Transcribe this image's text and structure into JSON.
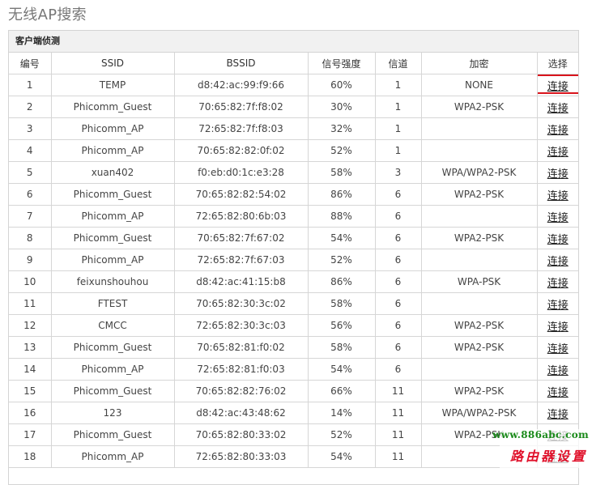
{
  "page": {
    "title": "无线AP搜索"
  },
  "panel": {
    "title": "客户端侦测"
  },
  "table": {
    "headers": [
      "编号",
      "SSID",
      "BSSID",
      "信号强度",
      "信道",
      "加密",
      "选择"
    ],
    "connect_label": "连接",
    "rows": [
      {
        "no": "1",
        "ssid": "TEMP",
        "bssid": "d8:42:ac:99:f9:66",
        "signal": "60%",
        "channel": "1",
        "enc": "NONE",
        "action": "连接",
        "highlighted": true
      },
      {
        "no": "2",
        "ssid": "Phicomm_Guest",
        "bssid": "70:65:82:7f:f8:02",
        "signal": "30%",
        "channel": "1",
        "enc": "WPA2-PSK",
        "action": "连接"
      },
      {
        "no": "3",
        "ssid": "Phicomm_AP",
        "bssid": "72:65:82:7f:f8:03",
        "signal": "32%",
        "channel": "1",
        "enc": "",
        "action": "连接"
      },
      {
        "no": "4",
        "ssid": "Phicomm_AP",
        "bssid": "70:65:82:82:0f:02",
        "signal": "52%",
        "channel": "1",
        "enc": "",
        "action": "连接"
      },
      {
        "no": "5",
        "ssid": "xuan402",
        "bssid": "f0:eb:d0:1c:e3:28",
        "signal": "58%",
        "channel": "3",
        "enc": "WPA/WPA2-PSK",
        "action": "连接"
      },
      {
        "no": "6",
        "ssid": "Phicomm_Guest",
        "bssid": "70:65:82:82:54:02",
        "signal": "86%",
        "channel": "6",
        "enc": "WPA2-PSK",
        "action": "连接"
      },
      {
        "no": "7",
        "ssid": "Phicomm_AP",
        "bssid": "72:65:82:80:6b:03",
        "signal": "88%",
        "channel": "6",
        "enc": "",
        "action": "连接"
      },
      {
        "no": "8",
        "ssid": "Phicomm_Guest",
        "bssid": "70:65:82:7f:67:02",
        "signal": "54%",
        "channel": "6",
        "enc": "WPA2-PSK",
        "action": "连接"
      },
      {
        "no": "9",
        "ssid": "Phicomm_AP",
        "bssid": "72:65:82:7f:67:03",
        "signal": "52%",
        "channel": "6",
        "enc": "",
        "action": "连接"
      },
      {
        "no": "10",
        "ssid": "feixunshouhou",
        "bssid": "d8:42:ac:41:15:b8",
        "signal": "86%",
        "channel": "6",
        "enc": "WPA-PSK",
        "action": "连接"
      },
      {
        "no": "11",
        "ssid": "FTEST",
        "bssid": "70:65:82:30:3c:02",
        "signal": "58%",
        "channel": "6",
        "enc": "",
        "action": "连接"
      },
      {
        "no": "12",
        "ssid": "CMCC",
        "bssid": "72:65:82:30:3c:03",
        "signal": "56%",
        "channel": "6",
        "enc": "WPA2-PSK",
        "action": "连接"
      },
      {
        "no": "13",
        "ssid": "Phicomm_Guest",
        "bssid": "70:65:82:81:f0:02",
        "signal": "58%",
        "channel": "6",
        "enc": "WPA2-PSK",
        "action": "连接"
      },
      {
        "no": "14",
        "ssid": "Phicomm_AP",
        "bssid": "72:65:82:81:f0:03",
        "signal": "54%",
        "channel": "6",
        "enc": "",
        "action": "连接"
      },
      {
        "no": "15",
        "ssid": "Phicomm_Guest",
        "bssid": "70:65:82:82:76:02",
        "signal": "66%",
        "channel": "11",
        "enc": "WPA2-PSK",
        "action": "连接"
      },
      {
        "no": "16",
        "ssid": "123",
        "bssid": "d8:42:ac:43:48:62",
        "signal": "14%",
        "channel": "11",
        "enc": "WPA/WPA2-PSK",
        "action": "连接"
      },
      {
        "no": "17",
        "ssid": "Phicomm_Guest",
        "bssid": "70:65:82:80:33:02",
        "signal": "52%",
        "channel": "11",
        "enc": "WPA2-PSK",
        "action": "连接"
      },
      {
        "no": "18",
        "ssid": "Phicomm_AP",
        "bssid": "72:65:82:80:33:03",
        "signal": "54%",
        "channel": "11",
        "enc": "",
        "action": "连接"
      }
    ]
  },
  "watermark": {
    "url": "www.886abc.com",
    "name": "路由器设置"
  },
  "colors": {
    "highlight": "#d9141c",
    "watermark_url": "#1a8a1a",
    "watermark_name": "#e0102a"
  }
}
